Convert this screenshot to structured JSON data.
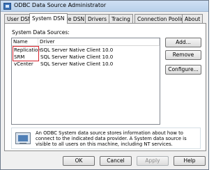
{
  "window": {
    "title": "ODBC Data Source Administrator"
  },
  "tabs": [
    {
      "label": "User DSN"
    },
    {
      "label": "System DSN"
    },
    {
      "label": "File DSN"
    },
    {
      "label": "Drivers"
    },
    {
      "label": "Tracing"
    },
    {
      "label": "Connection Pooling"
    },
    {
      "label": "About"
    }
  ],
  "active_tab": "System DSN",
  "panel": {
    "section_label": "System Data Sources:",
    "columns": [
      "Name",
      "Driver"
    ],
    "rows": [
      {
        "name": "Replication",
        "driver": "SQL Server Native Client 10.0"
      },
      {
        "name": "SRM",
        "driver": "SQL Server Native Client 10.0"
      },
      {
        "name": "vCenter",
        "driver": "SQL Server Native Client 10.0"
      }
    ],
    "buttons": {
      "add": "Add...",
      "remove": "Remove",
      "configure": "Configure..."
    },
    "info_text": "An ODBC System data source stores information about how to connect to the indicated data provider.  A System data source is visible to all users on this machine, including NT services."
  },
  "footer_buttons": {
    "ok": "OK",
    "cancel": "Cancel",
    "apply": "Apply",
    "help": "Help"
  },
  "colors": {
    "highlight_box": "#d6202a",
    "titlebar": "#b9d1ea"
  }
}
